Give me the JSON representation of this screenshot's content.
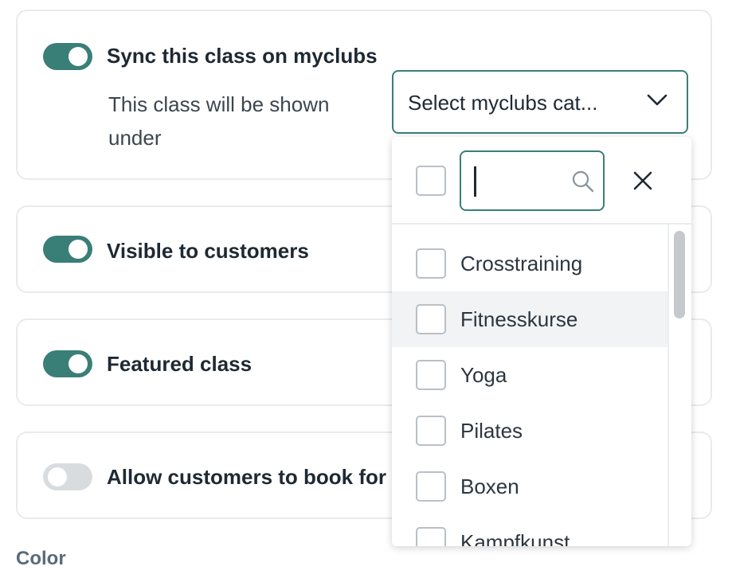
{
  "sync": {
    "label": "Sync this class on myclubs",
    "enabled": true,
    "description": "This class will be shown under",
    "select": {
      "placeholder": "Select myclubs cat...",
      "search_value": "",
      "options": [
        "Crosstraining",
        "Fitnesskurse",
        "Yoga",
        "Pilates",
        "Boxen",
        "Kampfkunst"
      ],
      "highlighted": "Fitnesskurse"
    }
  },
  "visible": {
    "label": "Visible to customers",
    "enabled": true
  },
  "featured": {
    "label": "Featured class",
    "enabled": true
  },
  "allow_book": {
    "label": "Allow customers to book for s",
    "enabled": false
  },
  "color_section": {
    "label": "Color"
  },
  "colors": {
    "accent": "#3a7f77",
    "toggle_off": "#d9dcdf"
  }
}
